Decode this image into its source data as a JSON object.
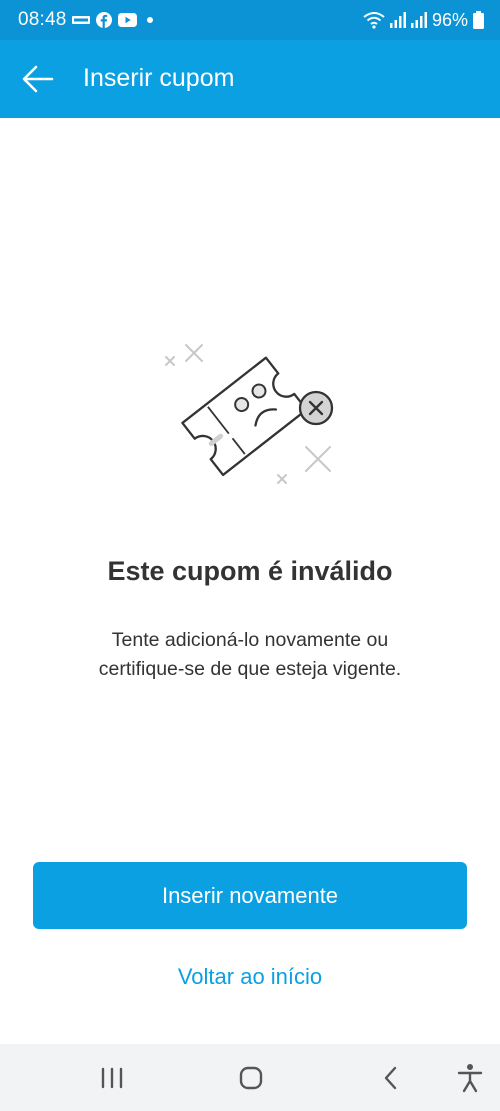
{
  "status_bar": {
    "time": "08:48",
    "battery": "96%",
    "icons": [
      "notification-icon",
      "facebook-icon",
      "youtube-icon",
      "dot-icon",
      "wifi-icon",
      "signal-icon",
      "battery-icon"
    ]
  },
  "app_bar": {
    "title": "Inserir cupom",
    "back_icon": "arrow-left-icon"
  },
  "message": {
    "illustration": "invalid-coupon-icon",
    "title": "Este cupom é inválido",
    "line1": "Tente adicioná-lo novamente ou",
    "line2": "certifique-se de que esteja vigente."
  },
  "actions": {
    "primary_label": "Inserir novamente",
    "secondary_label": "Voltar ao início"
  },
  "colors": {
    "brand": "#0ba0e2",
    "status_bar": "#0b93d5",
    "text": "#333333",
    "nav_background": "#f2f3f5"
  },
  "nav_bar": {
    "icons": [
      "recent-apps-icon",
      "home-icon",
      "back-icon",
      "accessibility-icon"
    ]
  }
}
